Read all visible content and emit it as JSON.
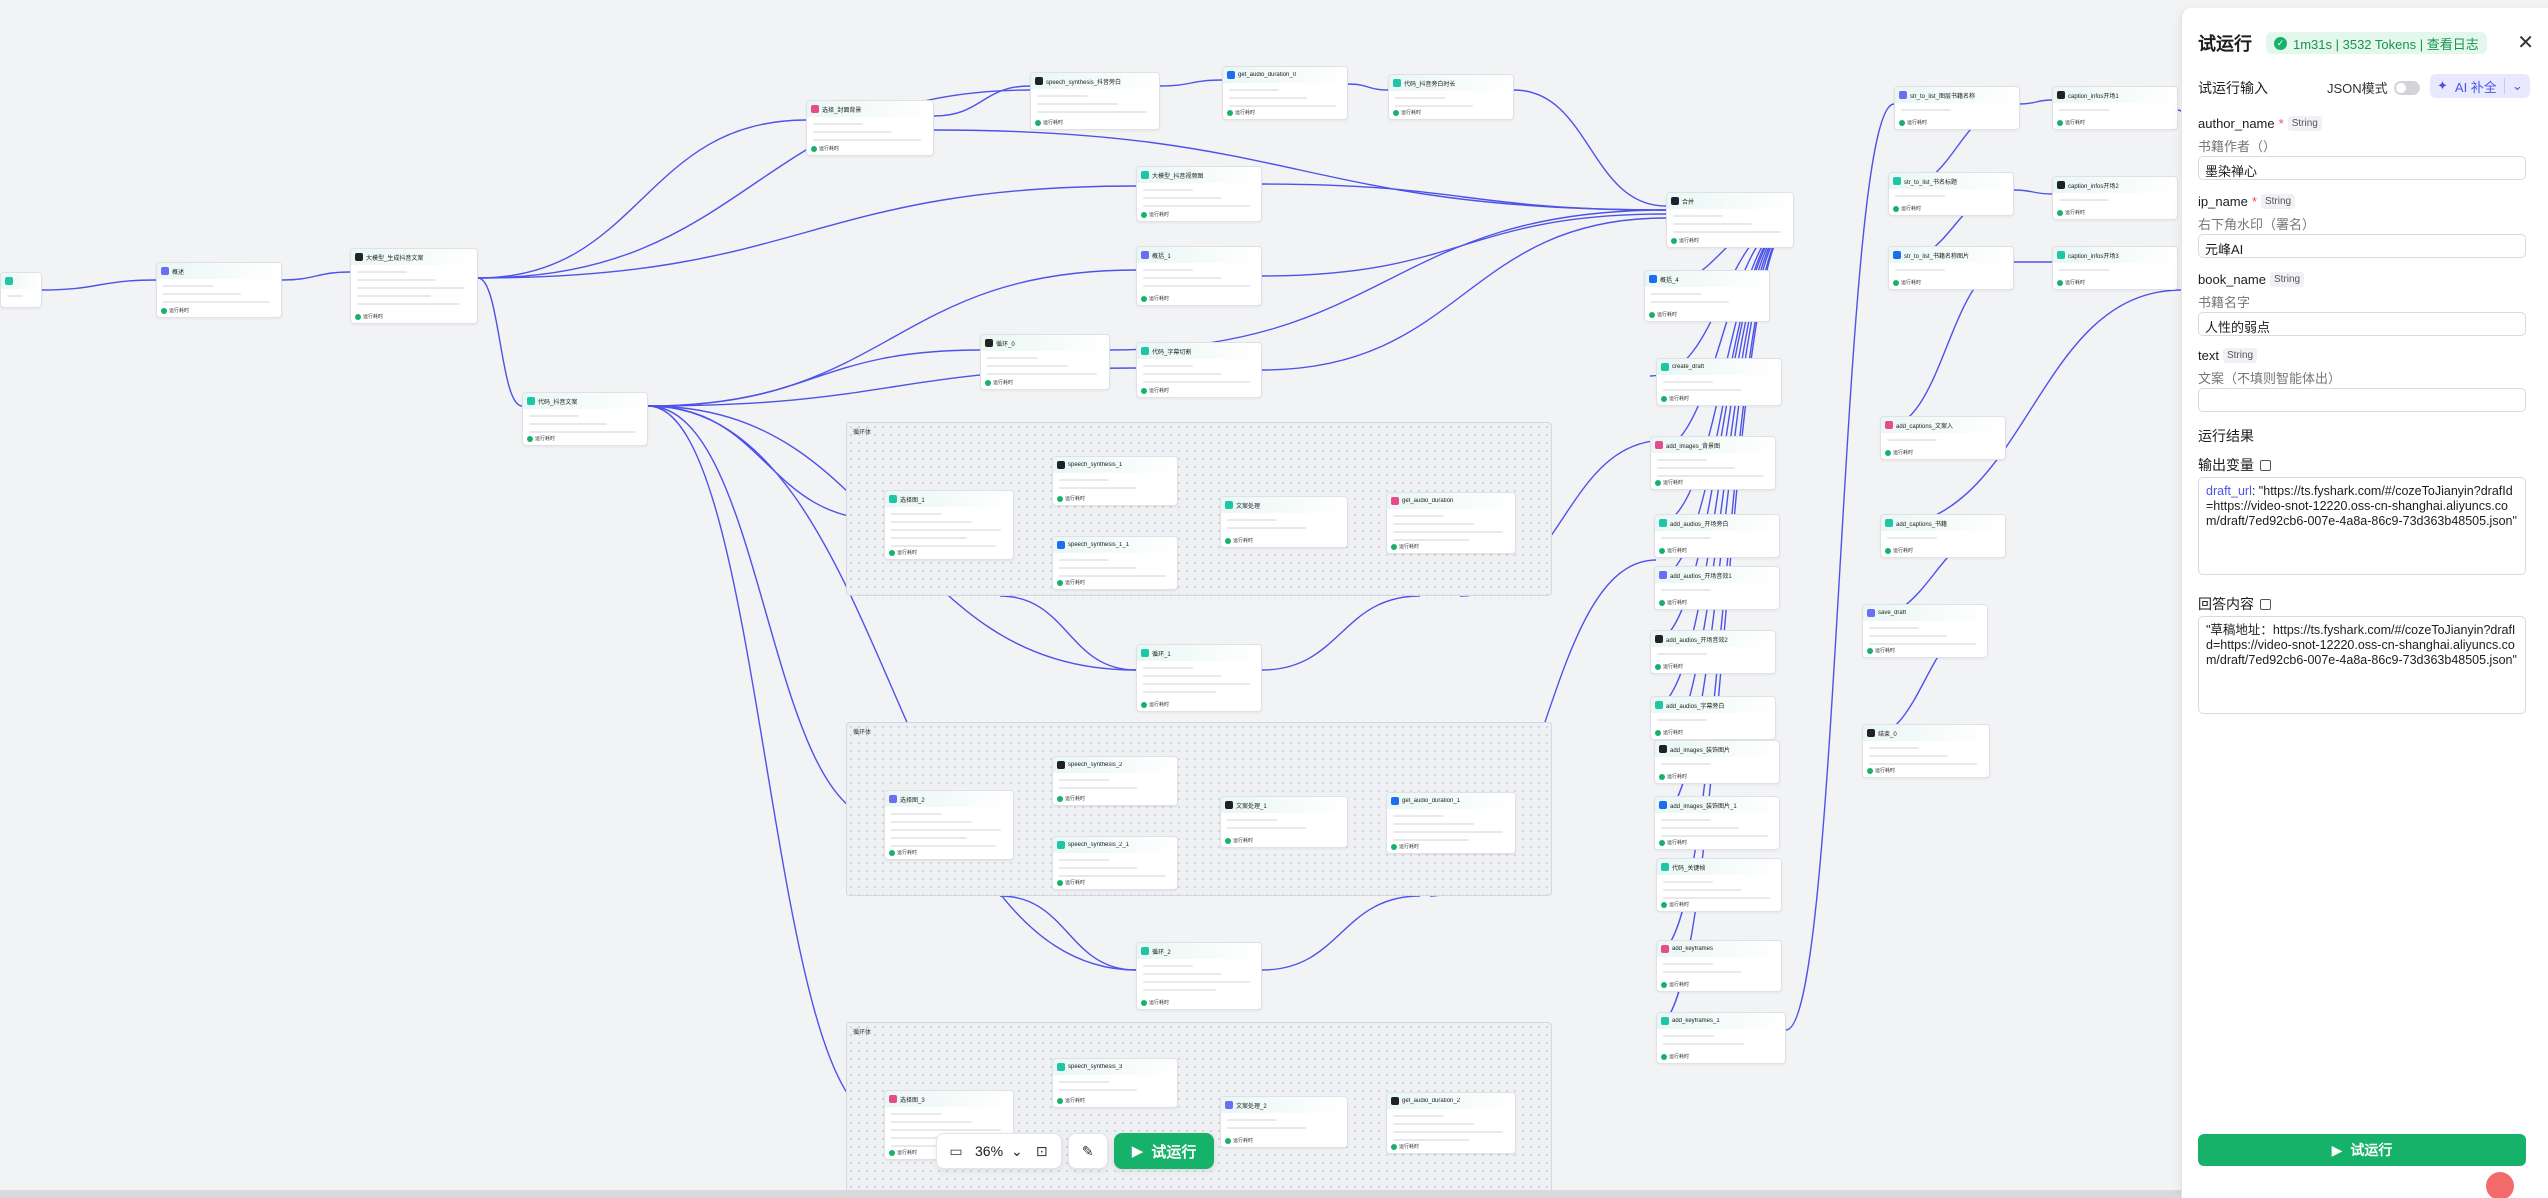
{
  "canvas": {
    "nodes": [
      {
        "title": "",
        "run": ""
      },
      {
        "title": "概述",
        "run": "运行耗时"
      },
      {
        "title": "大模型_生成抖音文案",
        "run": "运行耗时"
      },
      {
        "title": "代码_抖音文案",
        "run": "运行耗时"
      },
      {
        "title": "speech_synthesis_抖音旁白",
        "run": "运行耗时"
      },
      {
        "title": "get_audio_duration_0",
        "run": "运行耗时"
      },
      {
        "title": "代码_抖音旁白时长",
        "run": "运行耗时"
      },
      {
        "title": "选择_封面背景",
        "run": "运行耗时"
      },
      {
        "title": "大模型_抖音视频图",
        "run": "运行耗时"
      },
      {
        "title": "概括_1",
        "run": "运行耗时"
      },
      {
        "title": "循环_0",
        "run": "运行耗时"
      },
      {
        "title": "代码_字幕切割",
        "run": "运行耗时"
      },
      {
        "title": "合并",
        "run": "运行耗时"
      },
      {
        "title": "概括_4",
        "run": "运行耗时"
      },
      {
        "title": "create_draft",
        "run": "运行耗时"
      },
      {
        "title": "add_images_背景图",
        "run": "运行耗时"
      },
      {
        "title": "add_audios_开场旁白",
        "run": "运行耗时"
      },
      {
        "title": "add_audios_开场音效1",
        "run": "运行耗时"
      },
      {
        "title": "add_audios_开场音效2",
        "run": "运行耗时"
      },
      {
        "title": "add_audios_字幕旁白",
        "run": "运行耗时"
      },
      {
        "title": "add_images_装饰图片",
        "run": "运行耗时"
      },
      {
        "title": "add_images_装饰图片_1",
        "run": "运行耗时"
      },
      {
        "title": "代码_关键帧",
        "run": "运行耗时"
      },
      {
        "title": "add_keyframes",
        "run": "运行耗时"
      },
      {
        "title": "add_keyframes_1",
        "run": "运行耗时"
      },
      {
        "title": "str_to_list_图层书籍名称",
        "run": "运行耗时"
      },
      {
        "title": "caption_infos开场1",
        "run": "运行耗时"
      },
      {
        "title": "str_to_list_书名标题",
        "run": "运行耗时"
      },
      {
        "title": "caption_infos开场2",
        "run": "运行耗时"
      },
      {
        "title": "str_to_list_书籍名称图片",
        "run": "运行耗时"
      },
      {
        "title": "caption_infos开场3",
        "run": "运行耗时"
      },
      {
        "title": "add_captions_文案入",
        "run": "运行耗时"
      },
      {
        "title": "add_captions_书籍",
        "run": "运行耗时"
      },
      {
        "title": "save_draft",
        "run": "运行耗时"
      },
      {
        "title": "结束_0",
        "run": "运行耗时"
      },
      {
        "title": "选择图_1",
        "run": "运行耗时"
      },
      {
        "title": "speech_synthesis_1",
        "run": "运行耗时"
      },
      {
        "title": "speech_synthesis_1_1",
        "run": "运行耗时"
      },
      {
        "title": "文案处理",
        "run": "运行耗时"
      },
      {
        "title": "get_audio_duration",
        "run": "运行耗时"
      },
      {
        "title": "循环_1",
        "run": "运行耗时"
      },
      {
        "title": "选择图_2",
        "run": "运行耗时"
      },
      {
        "title": "speech_synthesis_2",
        "run": "运行耗时"
      },
      {
        "title": "speech_synthesis_2_1",
        "run": "运行耗时"
      },
      {
        "title": "文案处理_1",
        "run": "运行耗时"
      },
      {
        "title": "get_audio_duration_1",
        "run": "运行耗时"
      },
      {
        "title": "循环_2",
        "run": "运行耗时"
      },
      {
        "title": "选择图_3",
        "run": "运行耗时"
      },
      {
        "title": "speech_synthesis_3",
        "run": "运行耗时"
      },
      {
        "title": "文案处理_2",
        "run": "运行耗时"
      },
      {
        "title": "get_audio_duration_2",
        "run": "运行耗时"
      }
    ],
    "loops": [
      {
        "title": "循环体"
      },
      {
        "title": "循环体"
      },
      {
        "title": "循环体"
      }
    ]
  },
  "toolbar": {
    "zoom": "36%",
    "test_run": "试运行"
  },
  "panel": {
    "title": "试运行",
    "badge": "1m31s | 3532 Tokens | 查看日志",
    "input_title": "试运行输入",
    "json_mode": "JSON模式",
    "ai_fill": "AI 补全",
    "fields": [
      {
        "name": "author_name",
        "required": true,
        "type": "String",
        "desc": "书籍作者（）",
        "value": "墨染禅心"
      },
      {
        "name": "ip_name",
        "required": true,
        "type": "String",
        "desc": "右下角水印（署名）",
        "value": "元峰AI"
      },
      {
        "name": "book_name",
        "required": false,
        "type": "String",
        "desc": "书籍名字",
        "value": "人性的弱点"
      },
      {
        "name": "text",
        "required": false,
        "type": "String",
        "desc": "文案（不填则智能体出）",
        "value": ""
      }
    ],
    "result_title": "运行结果",
    "output_vars_title": "输出变量",
    "output_key": "draft_url",
    "output_value": ": \"https://ts.fyshark.com/#/cozeToJianyin?drafId=https://video-snot-12220.oss-cn-shanghai.aliyuncs.com/draft/7ed92cb6-007e-4a8a-86c9-73d363b48505.json\"",
    "answer_title": "回答内容",
    "answer_value": "\"草稿地址：https://ts.fyshark.com/#/cozeToJianyin?drafId=https://video-snot-12220.oss-cn-shanghai.aliyuncs.com/draft/7ed92cb6-007e-4a8a-86c9-73d363b48505.json\"",
    "run_button": "试运行"
  },
  "colors": {
    "accent_green": "#17b26a",
    "edge_blue": "#4d53e8",
    "ai_purple": "#4d53e8"
  }
}
